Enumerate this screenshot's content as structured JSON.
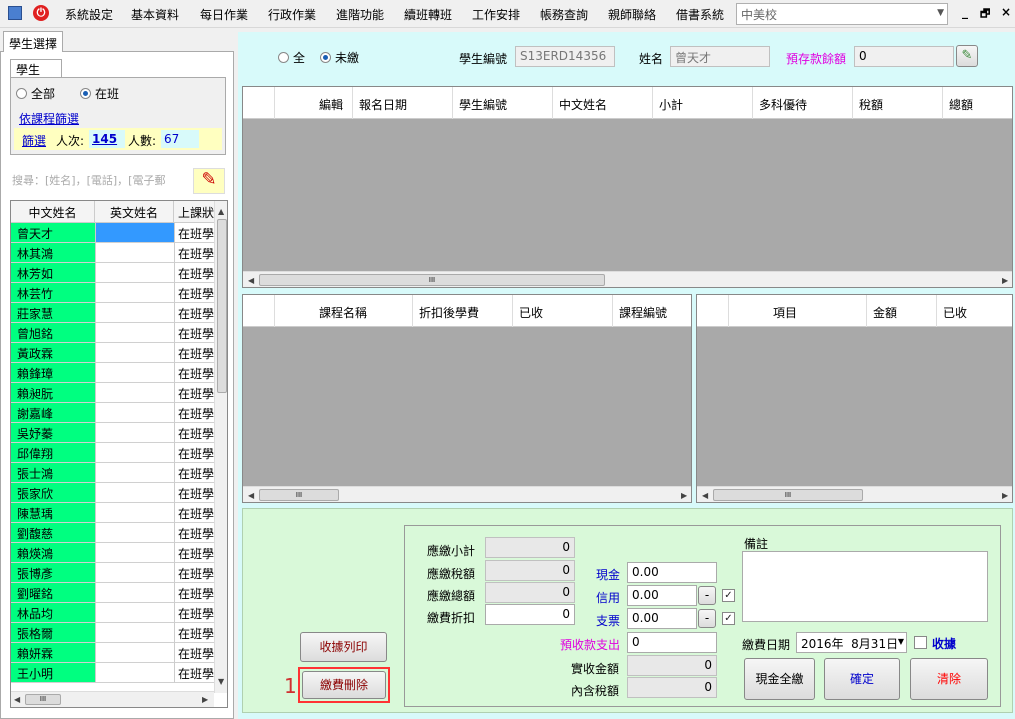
{
  "menu": {
    "items": [
      "系統設定",
      "基本資料",
      "每日作業",
      "行政作業",
      "進階功能",
      "續班轉班",
      "工作安排",
      "帳務查詢",
      "親師聯絡",
      "借書系統"
    ],
    "school": "中美校",
    "window_buttons": [
      "_",
      "🗗",
      "×"
    ]
  },
  "left": {
    "tab_label": "學生選擇",
    "student_tab": "學生",
    "radio_all": "全部",
    "radio_in_class": "在班",
    "course_filter_link": "依課程篩選",
    "filter_link": "篩選",
    "visits_label": "人次:",
    "visits_value": "145",
    "count_label": "人數:",
    "count_value": "67",
    "search_placeholder": "搜尋：[姓名]，[電話]，[電子郵",
    "grid": {
      "headers": [
        "中文姓名",
        "英文姓名",
        "上課狀"
      ],
      "rows": [
        {
          "cn": "曾天才",
          "en": "",
          "status": "在班學"
        },
        {
          "cn": "林其鴻",
          "en": "",
          "status": "在班學"
        },
        {
          "cn": "林芳如",
          "en": "",
          "status": "在班學"
        },
        {
          "cn": "林芸竹",
          "en": "",
          "status": "在班學"
        },
        {
          "cn": "莊家慧",
          "en": "",
          "status": "在班學"
        },
        {
          "cn": "曾旭銘",
          "en": "",
          "status": "在班學"
        },
        {
          "cn": "黃政霖",
          "en": "",
          "status": "在班學"
        },
        {
          "cn": "賴鋒璋",
          "en": "",
          "status": "在班學"
        },
        {
          "cn": "賴昶朊",
          "en": "",
          "status": "在班學"
        },
        {
          "cn": "謝嘉峰",
          "en": "",
          "status": "在班學"
        },
        {
          "cn": "吳妤蓁",
          "en": "",
          "status": "在班學"
        },
        {
          "cn": "邱偉翔",
          "en": "",
          "status": "在班學"
        },
        {
          "cn": "張士鴻",
          "en": "",
          "status": "在班學"
        },
        {
          "cn": "張家欣",
          "en": "",
          "status": "在班學"
        },
        {
          "cn": "陳慧瑀",
          "en": "",
          "status": "在班學"
        },
        {
          "cn": "劉馥慈",
          "en": "",
          "status": "在班學"
        },
        {
          "cn": "賴煐鴻",
          "en": "",
          "status": "在班學"
        },
        {
          "cn": "張博彥",
          "en": "",
          "status": "在班學"
        },
        {
          "cn": "劉曜銘",
          "en": "",
          "status": "在班學"
        },
        {
          "cn": "林品均",
          "en": "",
          "status": "在班學"
        },
        {
          "cn": "張格爾",
          "en": "",
          "status": "在班學"
        },
        {
          "cn": "賴妍霖",
          "en": "",
          "status": "在班學"
        },
        {
          "cn": "王小明",
          "en": "",
          "status": "在班學"
        }
      ]
    }
  },
  "top": {
    "radio_all": "全",
    "radio_unpaid": "未繳",
    "student_no_label": "學生編號",
    "student_no_value": "S13ERD14356",
    "name_label": "姓名",
    "name_value": "曾天才",
    "prepaid_label": "預存款餘額",
    "prepaid_value": "0"
  },
  "grid_main": {
    "headers": [
      "編輯",
      "報名日期",
      "學生編號",
      "中文姓名",
      "小計",
      "多科優待",
      "稅額",
      "總額"
    ]
  },
  "grid_courses": {
    "headers": [
      "課程名稱",
      "折扣後學費",
      "已收",
      "課程編號"
    ]
  },
  "grid_items": {
    "headers": [
      "項目",
      "金額",
      "已收"
    ]
  },
  "scroll_grip": "III",
  "fees": {
    "subtotal_label": "應繳小計",
    "subtotal": "0",
    "tax_label": "應繳稅額",
    "tax": "0",
    "total_label": "應繳總額",
    "total": "0",
    "discount_label": "繳費折扣",
    "discount": "0",
    "cash_label": "現金",
    "cash": "0.00",
    "credit_label": "信用",
    "credit": "0.00",
    "check_label": "支票",
    "check": "0.00",
    "prepaid_out_label": "預收款支出",
    "prepaid_out": "0",
    "received_label": "實收金額",
    "received": "0",
    "inner_tax_label": "內含稅額",
    "inner_tax": "0",
    "note_label": "備註",
    "date_label": "繳費日期",
    "date_value": "2016年  8月31日",
    "receipt_label": "收據",
    "minus_label": "-",
    "checkmark": "✓"
  },
  "buttons": {
    "print_receipt": "收據列印",
    "delete_payment": "繳費刪除",
    "annotation_number": "1",
    "cash_full": "現金全繳",
    "confirm": "確定",
    "clear": "清除"
  },
  "colors": {
    "green_row": "#00ff80",
    "accent_magenta": "#e000e0",
    "link_blue": "#0000cc",
    "clear_red": "#ff0000"
  }
}
